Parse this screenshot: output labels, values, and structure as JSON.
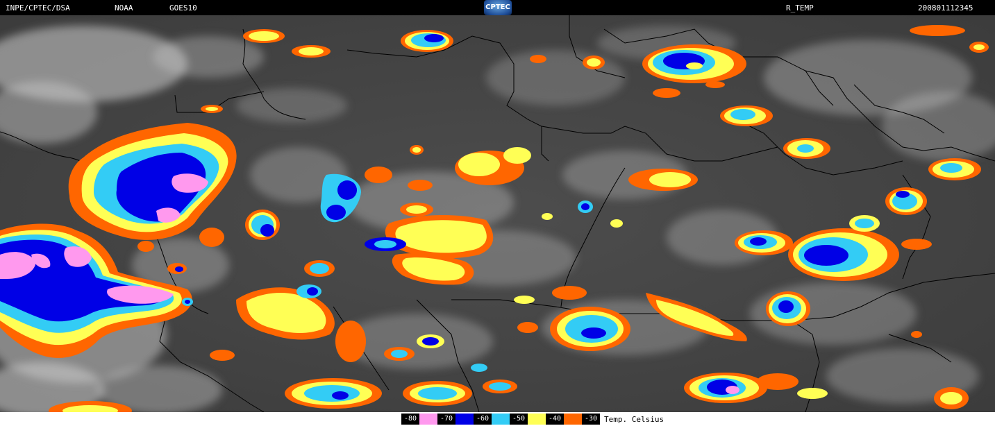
{
  "header": {
    "source": "INPE/CPTEC/DSA",
    "agency": "NOAA",
    "satellite": "GOES10",
    "logo_text": "CPTEC",
    "product": "R_TEMP",
    "datetime": "200801112345"
  },
  "legend": {
    "unit": "Temp. Celsius",
    "entries": [
      {
        "label": "-80",
        "color": "#ff99ee"
      },
      {
        "label": "-70",
        "color": "#0000e6"
      },
      {
        "label": "-60",
        "color": "#33ccf5"
      },
      {
        "label": "-50",
        "color": "#ffff55"
      },
      {
        "label": "-40",
        "color": "#ff6600"
      },
      {
        "label": "-30",
        "color": ""
      }
    ]
  },
  "colors": {
    "background_gray": "#4a4a4a",
    "cloud_white": "#d8d8d8",
    "border_lines": "#000000"
  }
}
